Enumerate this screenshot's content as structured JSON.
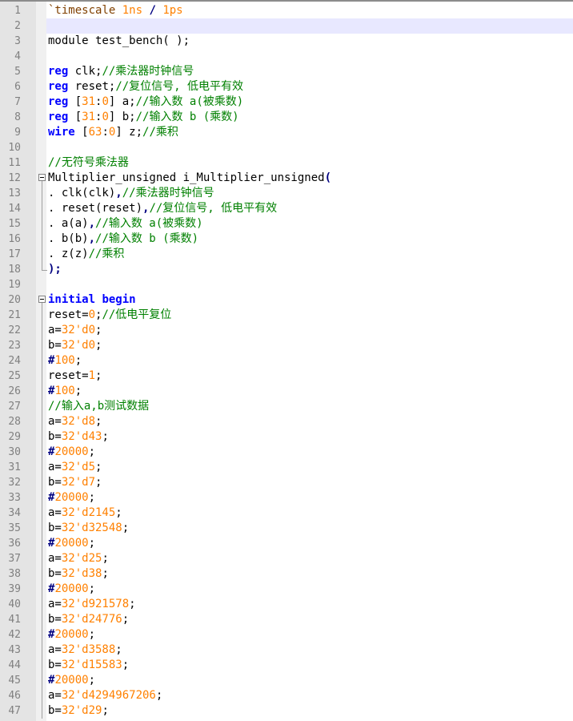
{
  "colors": {
    "keyword": "#0000ff",
    "number": "#ff8000",
    "comment": "#008000",
    "operator": "#000080",
    "plain": "#000000",
    "line_number": "#808080",
    "current_line": "#e8e8ff"
  },
  "editor": {
    "current_line": 2,
    "lines": [
      {
        "n": "1",
        "tokens": [
          {
            "t": "dir",
            "v": "`timescale "
          },
          {
            "t": "num",
            "v": "1ns"
          },
          {
            "t": "plain",
            "v": " "
          },
          {
            "t": "op",
            "v": "/"
          },
          {
            "t": "plain",
            "v": " "
          },
          {
            "t": "num",
            "v": "1ps"
          }
        ]
      },
      {
        "n": "2",
        "tokens": []
      },
      {
        "n": "3",
        "tokens": [
          {
            "t": "plain",
            "v": "module test_bench( );"
          }
        ]
      },
      {
        "n": "4",
        "tokens": []
      },
      {
        "n": "5",
        "tokens": [
          {
            "t": "kw",
            "v": "reg"
          },
          {
            "t": "plain",
            "v": " clk;"
          },
          {
            "t": "cm",
            "v": "//乘法器时钟信号"
          }
        ]
      },
      {
        "n": "6",
        "tokens": [
          {
            "t": "kw",
            "v": "reg"
          },
          {
            "t": "plain",
            "v": " reset;"
          },
          {
            "t": "cm",
            "v": "//复位信号, 低电平有效"
          }
        ]
      },
      {
        "n": "7",
        "tokens": [
          {
            "t": "kw",
            "v": "reg"
          },
          {
            "t": "plain",
            "v": " ["
          },
          {
            "t": "num",
            "v": "31"
          },
          {
            "t": "plain",
            "v": ":"
          },
          {
            "t": "num",
            "v": "0"
          },
          {
            "t": "plain",
            "v": "] a;"
          },
          {
            "t": "cm",
            "v": "//输入数 a(被乘数)"
          }
        ]
      },
      {
        "n": "8",
        "tokens": [
          {
            "t": "kw",
            "v": "reg"
          },
          {
            "t": "plain",
            "v": " ["
          },
          {
            "t": "num",
            "v": "31"
          },
          {
            "t": "plain",
            "v": ":"
          },
          {
            "t": "num",
            "v": "0"
          },
          {
            "t": "plain",
            "v": "] b;"
          },
          {
            "t": "cm",
            "v": "//输入数 b (乘数)"
          }
        ]
      },
      {
        "n": "9",
        "tokens": [
          {
            "t": "kw",
            "v": "wire"
          },
          {
            "t": "plain",
            "v": " ["
          },
          {
            "t": "num",
            "v": "63"
          },
          {
            "t": "plain",
            "v": ":"
          },
          {
            "t": "num",
            "v": "0"
          },
          {
            "t": "plain",
            "v": "] z;"
          },
          {
            "t": "cm",
            "v": "//乘积"
          }
        ]
      },
      {
        "n": "10",
        "tokens": []
      },
      {
        "n": "11",
        "tokens": [
          {
            "t": "cm",
            "v": "//无符号乘法器"
          }
        ]
      },
      {
        "n": "12",
        "fold": "open",
        "tokens": [
          {
            "t": "plain",
            "v": "Multiplier_unsigned i_Multiplier_unsigned"
          },
          {
            "t": "op",
            "v": "("
          }
        ]
      },
      {
        "n": "13",
        "fold": "line",
        "tokens": [
          {
            "t": "plain",
            "v": ". clk(clk)"
          },
          {
            "t": "op",
            "v": ","
          },
          {
            "t": "cm",
            "v": "//乘法器时钟信号"
          }
        ]
      },
      {
        "n": "14",
        "fold": "line",
        "tokens": [
          {
            "t": "plain",
            "v": ". reset(reset)"
          },
          {
            "t": "op",
            "v": ","
          },
          {
            "t": "cm",
            "v": "//复位信号, 低电平有效"
          }
        ]
      },
      {
        "n": "15",
        "fold": "line",
        "tokens": [
          {
            "t": "plain",
            "v": ". a(a)"
          },
          {
            "t": "op",
            "v": ","
          },
          {
            "t": "cm",
            "v": "//输入数 a(被乘数)"
          }
        ]
      },
      {
        "n": "16",
        "fold": "line",
        "tokens": [
          {
            "t": "plain",
            "v": ". b(b)"
          },
          {
            "t": "op",
            "v": ","
          },
          {
            "t": "cm",
            "v": "//输入数 b (乘数)"
          }
        ]
      },
      {
        "n": "17",
        "fold": "line",
        "tokens": [
          {
            "t": "plain",
            "v": ". z(z)"
          },
          {
            "t": "cm",
            "v": "//乘积"
          }
        ]
      },
      {
        "n": "18",
        "fold": "end",
        "tokens": [
          {
            "t": "op",
            "v": ");"
          }
        ]
      },
      {
        "n": "19",
        "tokens": []
      },
      {
        "n": "20",
        "fold": "open",
        "tokens": [
          {
            "t": "kw",
            "v": "initial"
          },
          {
            "t": "plain",
            "v": " "
          },
          {
            "t": "kw",
            "v": "begin"
          }
        ]
      },
      {
        "n": "21",
        "fold": "line",
        "tokens": [
          {
            "t": "plain",
            "v": "reset="
          },
          {
            "t": "num",
            "v": "0"
          },
          {
            "t": "plain",
            "v": ";"
          },
          {
            "t": "cm",
            "v": "//低电平复位"
          }
        ]
      },
      {
        "n": "22",
        "fold": "line",
        "tokens": [
          {
            "t": "plain",
            "v": "a="
          },
          {
            "t": "num",
            "v": "32'd0"
          },
          {
            "t": "plain",
            "v": ";"
          }
        ]
      },
      {
        "n": "23",
        "fold": "line",
        "tokens": [
          {
            "t": "plain",
            "v": "b="
          },
          {
            "t": "num",
            "v": "32'd0"
          },
          {
            "t": "plain",
            "v": ";"
          }
        ]
      },
      {
        "n": "24",
        "fold": "line",
        "tokens": [
          {
            "t": "op",
            "v": "#"
          },
          {
            "t": "num",
            "v": "100"
          },
          {
            "t": "plain",
            "v": ";"
          }
        ]
      },
      {
        "n": "25",
        "fold": "line",
        "tokens": [
          {
            "t": "plain",
            "v": "reset="
          },
          {
            "t": "num",
            "v": "1"
          },
          {
            "t": "plain",
            "v": ";"
          }
        ]
      },
      {
        "n": "26",
        "fold": "line",
        "tokens": [
          {
            "t": "op",
            "v": "#"
          },
          {
            "t": "num",
            "v": "100"
          },
          {
            "t": "plain",
            "v": ";"
          }
        ]
      },
      {
        "n": "27",
        "fold": "line",
        "tokens": [
          {
            "t": "cm",
            "v": "//输入a,b测试数据"
          }
        ]
      },
      {
        "n": "28",
        "fold": "line",
        "tokens": [
          {
            "t": "plain",
            "v": "a="
          },
          {
            "t": "num",
            "v": "32'd8"
          },
          {
            "t": "plain",
            "v": ";"
          }
        ]
      },
      {
        "n": "29",
        "fold": "line",
        "tokens": [
          {
            "t": "plain",
            "v": "b="
          },
          {
            "t": "num",
            "v": "32'd43"
          },
          {
            "t": "plain",
            "v": ";"
          }
        ]
      },
      {
        "n": "30",
        "fold": "line",
        "tokens": [
          {
            "t": "op",
            "v": "#"
          },
          {
            "t": "num",
            "v": "20000"
          },
          {
            "t": "plain",
            "v": ";"
          }
        ]
      },
      {
        "n": "31",
        "fold": "line",
        "tokens": [
          {
            "t": "plain",
            "v": "a="
          },
          {
            "t": "num",
            "v": "32'd5"
          },
          {
            "t": "plain",
            "v": ";"
          }
        ]
      },
      {
        "n": "32",
        "fold": "line",
        "tokens": [
          {
            "t": "plain",
            "v": "b="
          },
          {
            "t": "num",
            "v": "32'd7"
          },
          {
            "t": "plain",
            "v": ";"
          }
        ]
      },
      {
        "n": "33",
        "fold": "line",
        "tokens": [
          {
            "t": "op",
            "v": "#"
          },
          {
            "t": "num",
            "v": "20000"
          },
          {
            "t": "plain",
            "v": ";"
          }
        ]
      },
      {
        "n": "34",
        "fold": "line",
        "tokens": [
          {
            "t": "plain",
            "v": "a="
          },
          {
            "t": "num",
            "v": "32'd2145"
          },
          {
            "t": "plain",
            "v": ";"
          }
        ]
      },
      {
        "n": "35",
        "fold": "line",
        "tokens": [
          {
            "t": "plain",
            "v": "b="
          },
          {
            "t": "num",
            "v": "32'd32548"
          },
          {
            "t": "plain",
            "v": ";"
          }
        ]
      },
      {
        "n": "36",
        "fold": "line",
        "tokens": [
          {
            "t": "op",
            "v": "#"
          },
          {
            "t": "num",
            "v": "20000"
          },
          {
            "t": "plain",
            "v": ";"
          }
        ]
      },
      {
        "n": "37",
        "fold": "line",
        "tokens": [
          {
            "t": "plain",
            "v": "a="
          },
          {
            "t": "num",
            "v": "32'd25"
          },
          {
            "t": "plain",
            "v": ";"
          }
        ]
      },
      {
        "n": "38",
        "fold": "line",
        "tokens": [
          {
            "t": "plain",
            "v": "b="
          },
          {
            "t": "num",
            "v": "32'd38"
          },
          {
            "t": "plain",
            "v": ";"
          }
        ]
      },
      {
        "n": "39",
        "fold": "line",
        "tokens": [
          {
            "t": "op",
            "v": "#"
          },
          {
            "t": "num",
            "v": "20000"
          },
          {
            "t": "plain",
            "v": ";"
          }
        ]
      },
      {
        "n": "40",
        "fold": "line",
        "tokens": [
          {
            "t": "plain",
            "v": "a="
          },
          {
            "t": "num",
            "v": "32'd921578"
          },
          {
            "t": "plain",
            "v": ";"
          }
        ]
      },
      {
        "n": "41",
        "fold": "line",
        "tokens": [
          {
            "t": "plain",
            "v": "b="
          },
          {
            "t": "num",
            "v": "32'd24776"
          },
          {
            "t": "plain",
            "v": ";"
          }
        ]
      },
      {
        "n": "42",
        "fold": "line",
        "tokens": [
          {
            "t": "op",
            "v": "#"
          },
          {
            "t": "num",
            "v": "20000"
          },
          {
            "t": "plain",
            "v": ";"
          }
        ]
      },
      {
        "n": "43",
        "fold": "line",
        "tokens": [
          {
            "t": "plain",
            "v": "a="
          },
          {
            "t": "num",
            "v": "32'd3588"
          },
          {
            "t": "plain",
            "v": ";"
          }
        ]
      },
      {
        "n": "44",
        "fold": "line",
        "tokens": [
          {
            "t": "plain",
            "v": "b="
          },
          {
            "t": "num",
            "v": "32'd15583"
          },
          {
            "t": "plain",
            "v": ";"
          }
        ]
      },
      {
        "n": "45",
        "fold": "line",
        "tokens": [
          {
            "t": "op",
            "v": "#"
          },
          {
            "t": "num",
            "v": "20000"
          },
          {
            "t": "plain",
            "v": ";"
          }
        ]
      },
      {
        "n": "46",
        "fold": "line",
        "tokens": [
          {
            "t": "plain",
            "v": "a="
          },
          {
            "t": "num",
            "v": "32'd4294967206"
          },
          {
            "t": "plain",
            "v": ";"
          }
        ]
      },
      {
        "n": "47",
        "fold": "line",
        "tokens": [
          {
            "t": "plain",
            "v": "b="
          },
          {
            "t": "num",
            "v": "32'd29"
          },
          {
            "t": "plain",
            "v": ";"
          }
        ]
      }
    ]
  }
}
